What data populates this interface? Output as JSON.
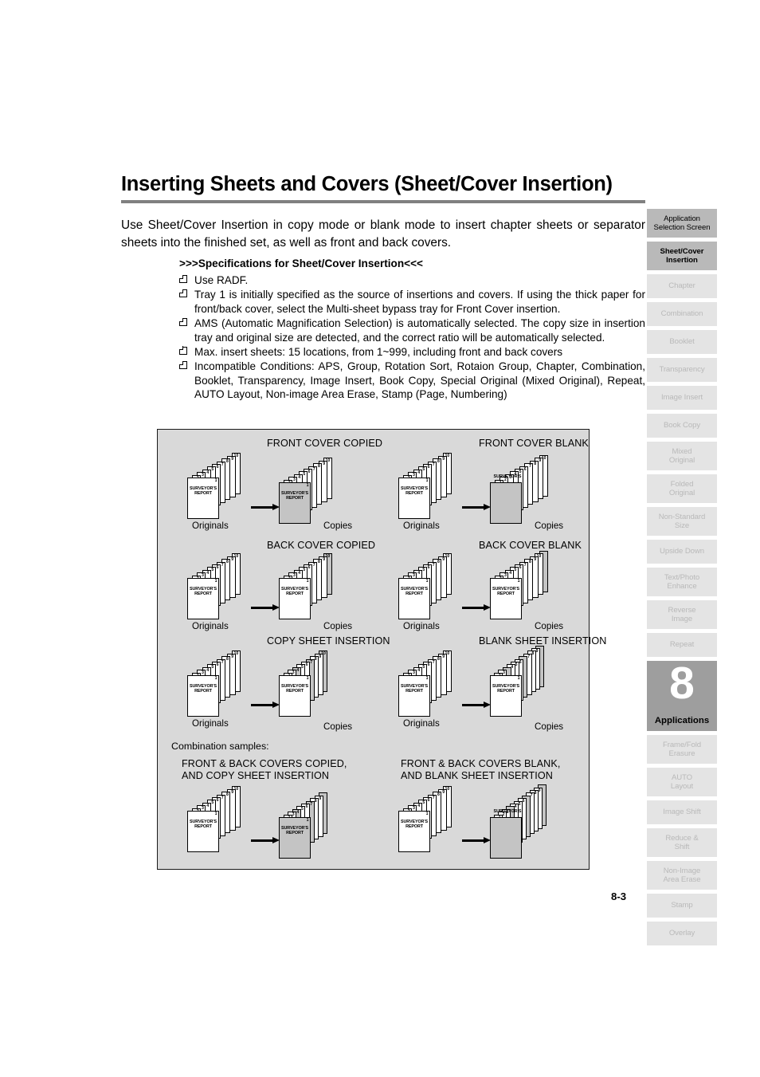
{
  "document": {
    "title": "Inserting Sheets and Covers (Sheet/Cover Insertion)",
    "intro": "Use Sheet/Cover Insertion in copy mode or blank mode to insert chapter sheets or separator sheets into the finished set, as well as front and back covers.",
    "page_number": "8-3"
  },
  "specifications": {
    "heading": ">>>Specifications for Sheet/Cover Insertion<<<",
    "items": [
      "Use RADF.",
      "Tray 1 is initially specified as the source of insertions and covers. If using the thick paper for front/back cover, select the Multi-sheet bypass tray for Front Cover insertion.",
      "AMS (Automatic Magnification Selection) is automatically selected. The copy size in insertion tray and original size are detected, and the correct ratio will be automatically selected.",
      "Max. insert sheets: 15 locations, from 1~999, including front and back covers",
      "Incompatible Conditions: APS, Group, Rotation Sort, Rotaion Group, Chapter, Combination, Booklet, Transparency, Image Insert, Book Copy, Special Original (Mixed Original), Repeat, AUTO Layout, Non-image Area Erase, Stamp (Page, Numbering)"
    ]
  },
  "illustrations": {
    "combination_label": "Combination samples:",
    "sheet_text": "SURVEYOR'S REPORT",
    "sheet_text_line1": "SURVEYOR'S",
    "sheet_text_line2": "REPORT",
    "caption_originals": "Originals",
    "caption_copies": "Copies",
    "figures": [
      {
        "title": "FRONT COVER COPIED"
      },
      {
        "title": "FRONT COVER BLANK"
      },
      {
        "title": "BACK COVER COPIED"
      },
      {
        "title": "BACK COVER BLANK"
      },
      {
        "title": "COPY SHEET INSERTION"
      },
      {
        "title": "BLANK SHEET INSERTION"
      },
      {
        "title_line1": "FRONT & BACK COVERS COPIED,",
        "title_line2": "AND COPY SHEET INSERTION"
      },
      {
        "title_line1": "FRONT & BACK COVERS BLANK,",
        "title_line2": "AND BLANK SHEET INSERTION"
      }
    ]
  },
  "sidebar": {
    "items": [
      {
        "label_line1": "Application",
        "label_line2": "Selection Screen",
        "state": "active"
      },
      {
        "label_line1": "Sheet/Cover",
        "label_line2": "Insertion",
        "state": "current"
      },
      {
        "label_line1": "Chapter",
        "label_line2": "",
        "state": "inactive"
      },
      {
        "label_line1": "Combination",
        "label_line2": "",
        "state": "inactive"
      },
      {
        "label_line1": "Booklet",
        "label_line2": "",
        "state": "inactive"
      },
      {
        "label_line1": "Transparency",
        "label_line2": "",
        "state": "inactive"
      },
      {
        "label_line1": "Image Insert",
        "label_line2": "",
        "state": "inactive"
      },
      {
        "label_line1": "Book Copy",
        "label_line2": "",
        "state": "inactive"
      },
      {
        "label_line1": "Mixed",
        "label_line2": "Original",
        "state": "inactive"
      },
      {
        "label_line1": "Folded",
        "label_line2": "Original",
        "state": "inactive"
      },
      {
        "label_line1": "Non-Standard",
        "label_line2": "Size",
        "state": "inactive"
      },
      {
        "label_line1": "Upside Down",
        "label_line2": "",
        "state": "inactive"
      },
      {
        "label_line1": "Text/Photo",
        "label_line2": "Enhance",
        "state": "inactive"
      },
      {
        "label_line1": "Reverse",
        "label_line2": "Image",
        "state": "inactive"
      },
      {
        "label_line1": "Repeat",
        "label_line2": "",
        "state": "inactive"
      }
    ],
    "chapter_marker": {
      "number": "8",
      "name": "Applications"
    },
    "items_after": [
      {
        "label_line1": "Frame/Fold",
        "label_line2": "Erasure",
        "state": "inactive"
      },
      {
        "label_line1": "AUTO",
        "label_line2": "Layout",
        "state": "inactive"
      },
      {
        "label_line1": "Image Shift",
        "label_line2": "",
        "state": "inactive"
      },
      {
        "label_line1": "Reduce &",
        "label_line2": "Shift",
        "state": "inactive"
      },
      {
        "label_line1": "Non-Image",
        "label_line2": "Area Erase",
        "state": "inactive"
      },
      {
        "label_line1": "Stamp",
        "label_line2": "",
        "state": "inactive"
      },
      {
        "label_line1": "Overlay",
        "label_line2": "",
        "state": "inactive"
      }
    ]
  }
}
